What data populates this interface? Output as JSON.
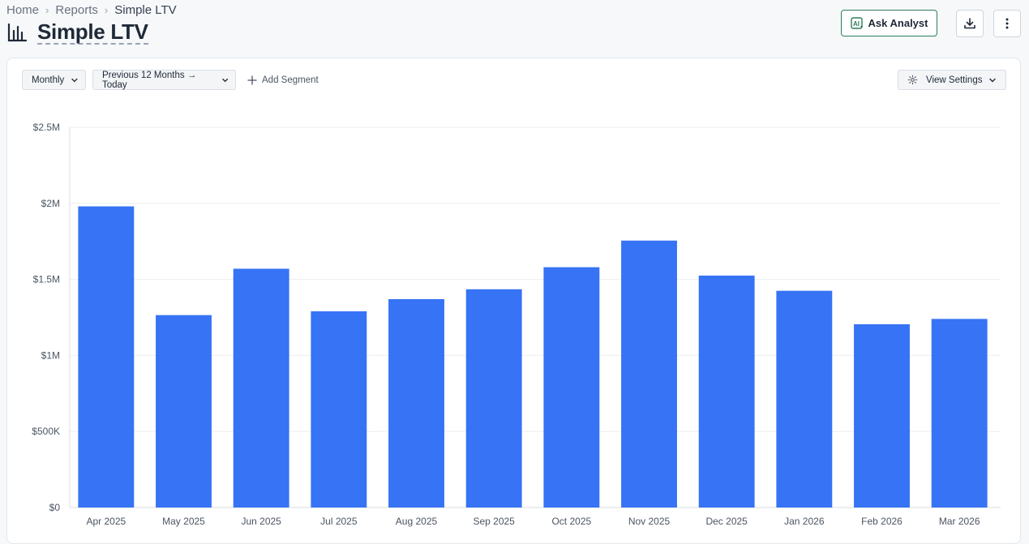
{
  "breadcrumb": {
    "home": "Home",
    "reports": "Reports",
    "current": "Simple LTV"
  },
  "header": {
    "title": "Simple LTV",
    "ask_analyst": "Ask Analyst",
    "icons": [
      "bar-chart-icon",
      "ai-icon",
      "download-icon",
      "more-vertical-icon"
    ],
    "accent_color": "#2e7d5b"
  },
  "controls": {
    "granularity": "Monthly",
    "date_range": "Previous 12 Months → Today",
    "add_segment": "Add Segment",
    "view_settings": "View Settings"
  },
  "chart_data": {
    "type": "bar",
    "title": "",
    "xlabel": "",
    "ylabel": "",
    "categories": [
      "Apr 2025",
      "May 2025",
      "Jun 2025",
      "Jul 2025",
      "Aug 2025",
      "Sep 2025",
      "Oct 2025",
      "Nov 2025",
      "Dec 2025",
      "Jan 2026",
      "Feb 2026",
      "Mar 2026"
    ],
    "values": [
      1980000,
      1265000,
      1570000,
      1290000,
      1370000,
      1435000,
      1580000,
      1755000,
      1525000,
      1425000,
      1205000,
      1240000
    ],
    "ylim": [
      0,
      2500000
    ],
    "yticks": [
      0,
      500000,
      1000000,
      1500000,
      2000000,
      2500000
    ],
    "ytick_labels": [
      "$0",
      "$500K",
      "$1M",
      "$1.5M",
      "$2M",
      "$2.5M"
    ],
    "bar_color": "#3673f5",
    "grid": true,
    "legend": "none"
  }
}
